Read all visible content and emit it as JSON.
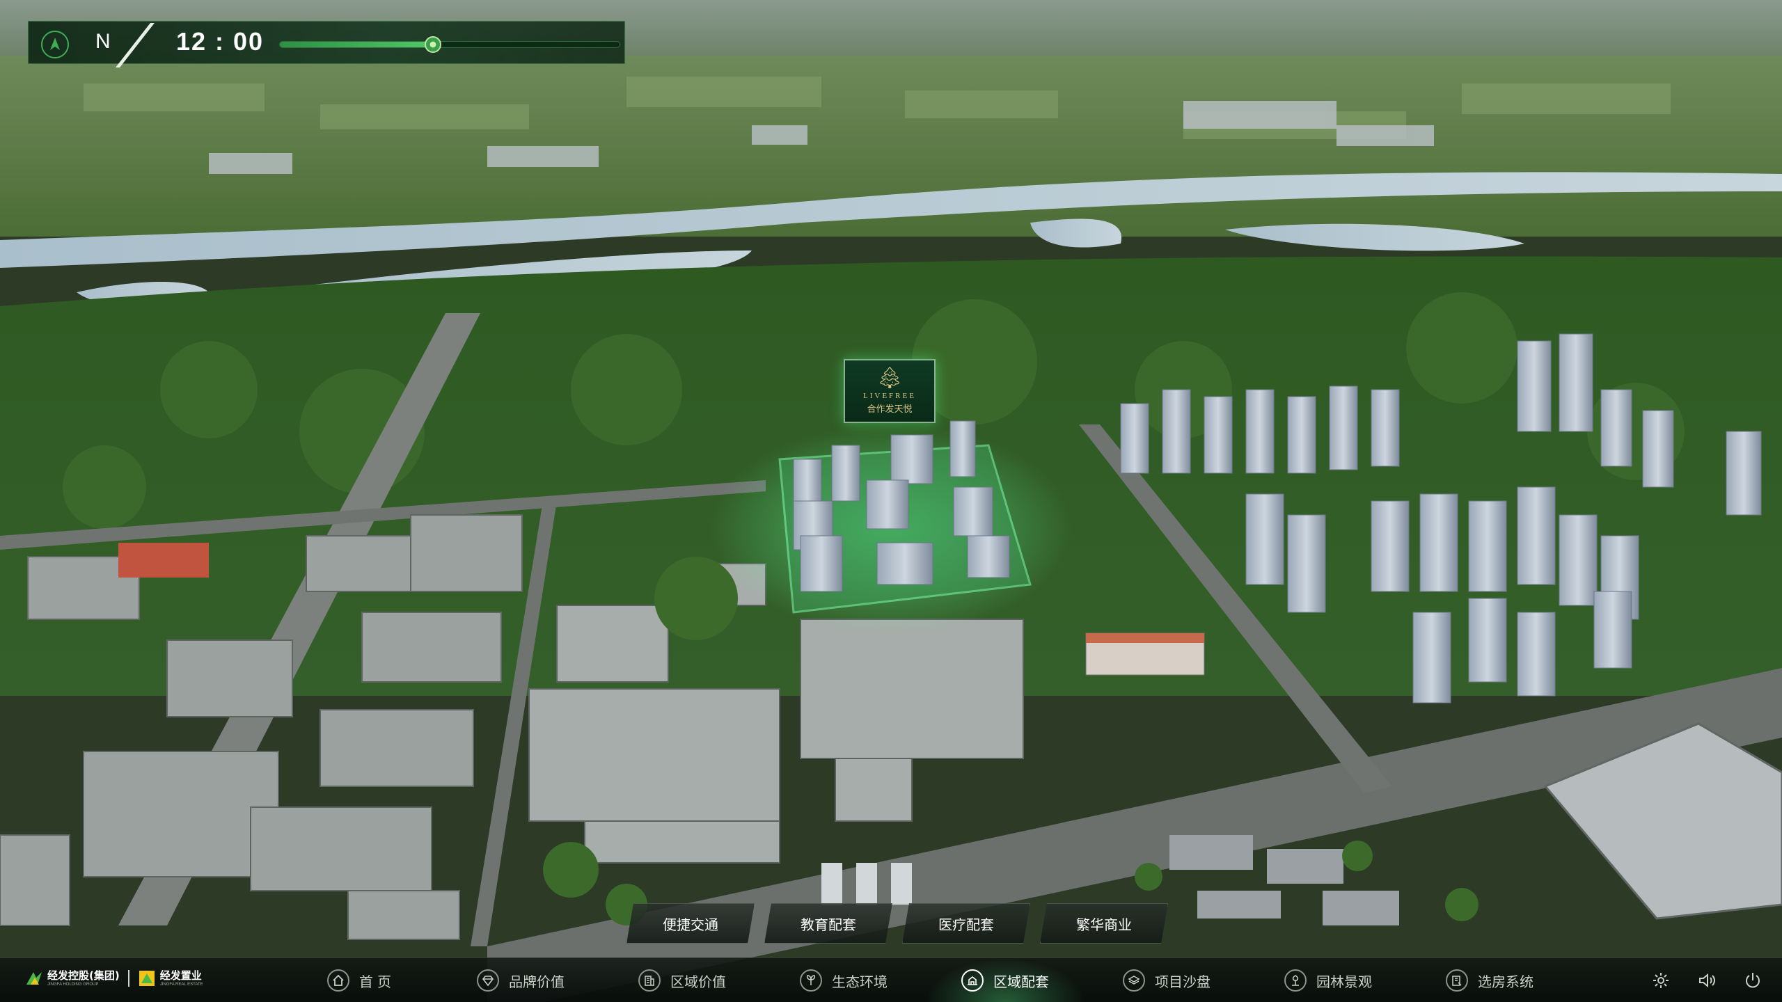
{
  "time_panel": {
    "direction": "N",
    "time": "12 : 00",
    "slider_value": 0.45,
    "icons": [
      "compass-icon"
    ]
  },
  "project_sign": {
    "name_en": "LIVEFREE",
    "name_cn": "合作发天悦",
    "icon": "tree-logo-icon"
  },
  "sub_tabs": [
    {
      "label": "便捷交通"
    },
    {
      "label": "教育配套"
    },
    {
      "label": "医疗配套"
    },
    {
      "label": "繁华商业"
    }
  ],
  "brand": {
    "group_name": "经发控股(集团)",
    "group_sub": "JINGFA HOLDING GROUP",
    "company_name": "经发置业",
    "company_sub": "JINGFA REAL ESTATE"
  },
  "nav": [
    {
      "label": "首 页",
      "icon": "home-icon"
    },
    {
      "label": "品牌价值",
      "icon": "diamond-icon"
    },
    {
      "label": "区域价值",
      "icon": "building-icon"
    },
    {
      "label": "生态环境",
      "icon": "leaf-icon"
    },
    {
      "label": "区域配套",
      "icon": "facilities-icon",
      "active": true
    },
    {
      "label": "项目沙盘",
      "icon": "layers-icon"
    },
    {
      "label": "园林景观",
      "icon": "garden-icon"
    },
    {
      "label": "选房系统",
      "icon": "house-select-icon"
    }
  ],
  "system_icons": [
    "settings-icon",
    "volume-icon",
    "power-icon"
  ],
  "colors": {
    "accent": "#3fae55",
    "panel_bg": "#0e2614",
    "active_glow": "#46be6e"
  }
}
